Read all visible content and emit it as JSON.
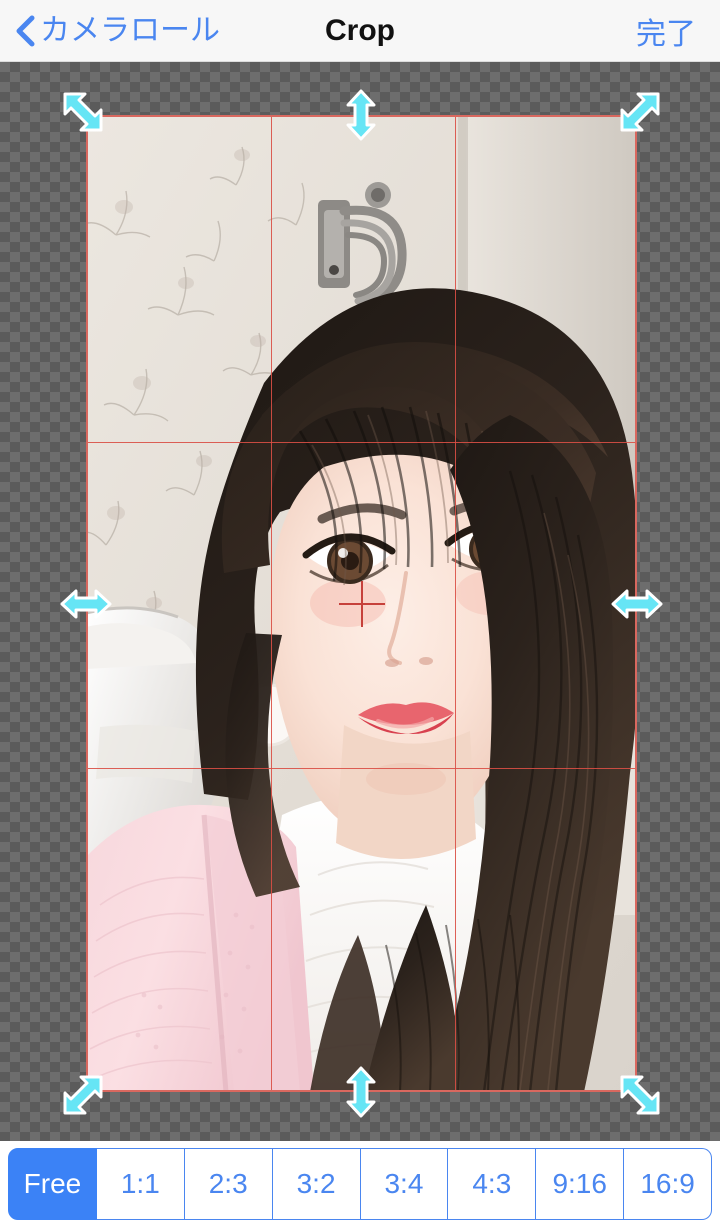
{
  "navbar": {
    "back_icon": "chevron-left-icon",
    "back_label": "カメラロール",
    "title": "Crop",
    "done_label": "完了"
  },
  "editor": {
    "background": "transparency-checkerboard",
    "crop": {
      "border_color": "#d9685f",
      "grid_color": "#d94f45",
      "grid": "rule-of-thirds",
      "handle_color": "#66e5f5",
      "handles": [
        {
          "name": "crop-handle-top-left",
          "icon": "resize-diagonal-nwse-icon"
        },
        {
          "name": "crop-handle-top-center",
          "icon": "resize-vertical-icon"
        },
        {
          "name": "crop-handle-top-right",
          "icon": "resize-diagonal-nesw-icon"
        },
        {
          "name": "crop-handle-middle-left",
          "icon": "resize-horizontal-icon"
        },
        {
          "name": "crop-handle-middle-right",
          "icon": "resize-horizontal-icon"
        },
        {
          "name": "crop-handle-bottom-left",
          "icon": "resize-diagonal-nesw-icon"
        },
        {
          "name": "crop-handle-bottom-center",
          "icon": "resize-vertical-icon"
        },
        {
          "name": "crop-handle-bottom-right",
          "icon": "resize-diagonal-nwse-icon"
        }
      ],
      "center_marker": "crosshair-icon"
    },
    "photo": {
      "description": "selfie of a young woman with long dark hair wearing a pink knit cardigan over a white top, standing in a bathroom with pale floral wallpaper and a white toilet"
    }
  },
  "ratio_bar": {
    "selected": "Free",
    "options": [
      {
        "label": "Free",
        "selected": true
      },
      {
        "label": "1:1",
        "selected": false
      },
      {
        "label": "2:3",
        "selected": false
      },
      {
        "label": "3:2",
        "selected": false
      },
      {
        "label": "3:4",
        "selected": false
      },
      {
        "label": "4:3",
        "selected": false
      },
      {
        "label": "9:16",
        "selected": false
      },
      {
        "label": "16:9",
        "selected": false
      }
    ],
    "accent_color": "#3b82f6"
  }
}
